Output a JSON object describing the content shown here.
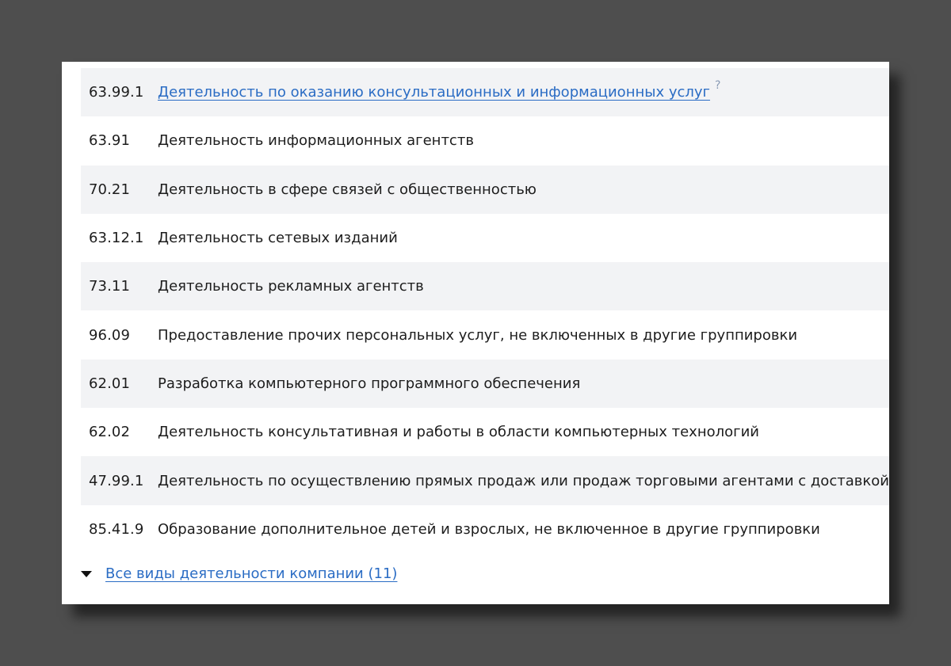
{
  "activities": [
    {
      "code": "63.99.1",
      "name": "Деятельность по оказанию консультационных и информационных услуг",
      "is_link": true,
      "help_mark": "?"
    },
    {
      "code": "63.91",
      "name": "Деятельность информационных агентств"
    },
    {
      "code": "70.21",
      "name": "Деятельность в сфере связей с общественностью"
    },
    {
      "code": "63.12.1",
      "name": "Деятельность сетевых изданий"
    },
    {
      "code": "73.11",
      "name": "Деятельность рекламных агентств"
    },
    {
      "code": "96.09",
      "name": "Предоставление прочих персональных услуг, не включенных в другие группировки"
    },
    {
      "code": "62.01",
      "name": "Разработка компьютерного программного обеспечения"
    },
    {
      "code": "62.02",
      "name": "Деятельность консультативная и работы в области компьютерных технологий"
    },
    {
      "code": "47.99.1",
      "name": "Деятельность по осуществлению прямых продаж или продаж торговыми агентами с доставкой"
    },
    {
      "code": "85.41.9",
      "name": "Образование дополнительное детей и взрослых, не включенное в другие группировки"
    }
  ],
  "all_activities_link": "Все виды деятельности компании (11)",
  "colors": {
    "link": "#2a6cc4",
    "row_alt_bg": "#f2f3f5",
    "page_bg": "#4e4e4e"
  }
}
